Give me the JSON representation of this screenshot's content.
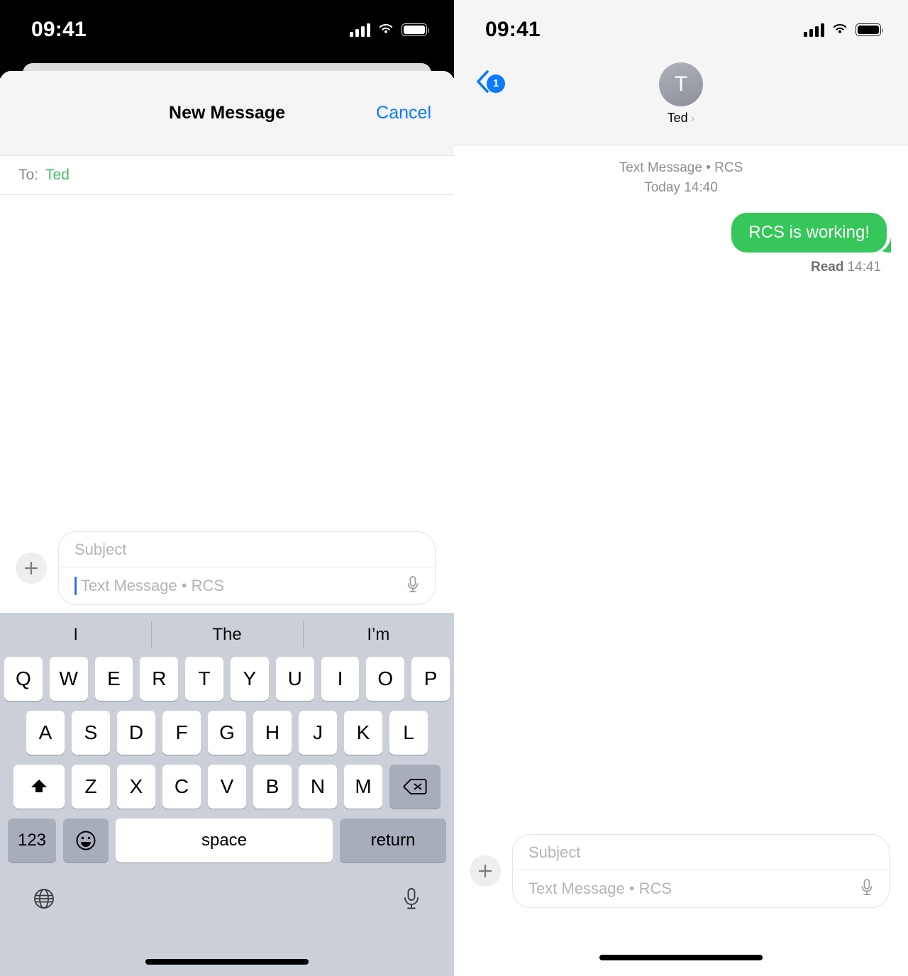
{
  "left_phone": {
    "status_bar": {
      "time": "09:41",
      "icons": [
        "cellular-signal-icon",
        "wifi-icon",
        "battery-icon"
      ]
    },
    "sheet": {
      "title": "New Message",
      "cancel_label": "Cancel"
    },
    "recipient": {
      "to_label": "To:",
      "name": "Ted"
    },
    "composer": {
      "plus_icon": "plus-icon",
      "subject_placeholder": "Subject",
      "message_placeholder": "Text Message • RCS",
      "mic_icon": "microphone-icon",
      "cursor_visible": true
    },
    "keyboard": {
      "predictions": [
        "I",
        "The",
        "I’m"
      ],
      "row1": [
        "Q",
        "W",
        "E",
        "R",
        "T",
        "Y",
        "U",
        "I",
        "O",
        "P"
      ],
      "row2": [
        "A",
        "S",
        "D",
        "F",
        "G",
        "H",
        "J",
        "K",
        "L"
      ],
      "row3": [
        "Z",
        "X",
        "C",
        "V",
        "B",
        "N",
        "M"
      ],
      "shift_icon": "shift-key-icon",
      "delete_icon": "backspace-key-icon",
      "numbers_label": "123",
      "emoji_icon": "emoji-key-icon",
      "space_label": "space",
      "return_label": "return",
      "globe_icon": "globe-key-icon",
      "dictation_icon": "dictation-microphone-icon"
    }
  },
  "right_phone": {
    "status_bar": {
      "time": "09:41",
      "icons": [
        "cellular-signal-icon",
        "wifi-icon",
        "battery-icon"
      ]
    },
    "header": {
      "back_badge_count": "1",
      "avatar_initial": "T",
      "contact_name": "Ted",
      "chevron": "›"
    },
    "conversation": {
      "service_label": "Text Message • RCS",
      "timestamp": "Today 14:40",
      "messages": [
        {
          "text": "RCS is working!",
          "direction": "outgoing",
          "status_label": "Read",
          "status_time": "14:41"
        }
      ]
    },
    "composer": {
      "plus_icon": "plus-icon",
      "subject_placeholder": "Subject",
      "message_placeholder": "Text Message • RCS",
      "mic_icon": "microphone-icon"
    }
  },
  "colors": {
    "accent_blue": "#0A7AFF",
    "bubble_green": "#35C759",
    "recipient_green": "#3FBF63",
    "keyboard_bg": "#CBD0D8",
    "placeholder_gray": "#B4B4B8"
  }
}
